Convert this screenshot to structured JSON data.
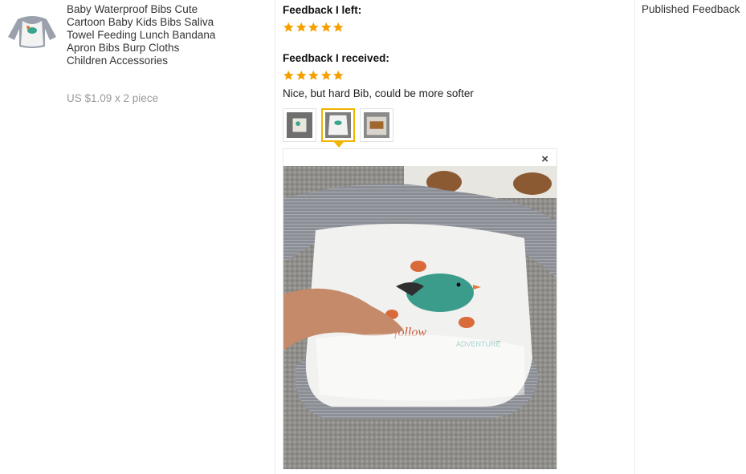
{
  "product": {
    "title": "Baby Waterproof Bibs Cute Cartoon Baby Kids Bibs Saliva Towel Feeding Lunch Bandana Apron Bibs Burp Cloths Children Accessories",
    "price": "US $1.09 x 2 piece",
    "thumbnail_icon": "baby-bib-image"
  },
  "feedback": {
    "left_heading": "Feedback I left:",
    "left_rating": 5,
    "received_heading": "Feedback I received:",
    "received_rating": 5,
    "comment": "Nice, but hard Bib, could be more softer",
    "star_color": "#f5a000",
    "photos": [
      "photo-1",
      "photo-2",
      "photo-3"
    ],
    "selected_photo_index": 1,
    "close_label": "×"
  },
  "actions": {
    "published_label": "Published Feedback"
  },
  "colors": {
    "accent": "#f0b400",
    "muted_text": "#999999"
  }
}
